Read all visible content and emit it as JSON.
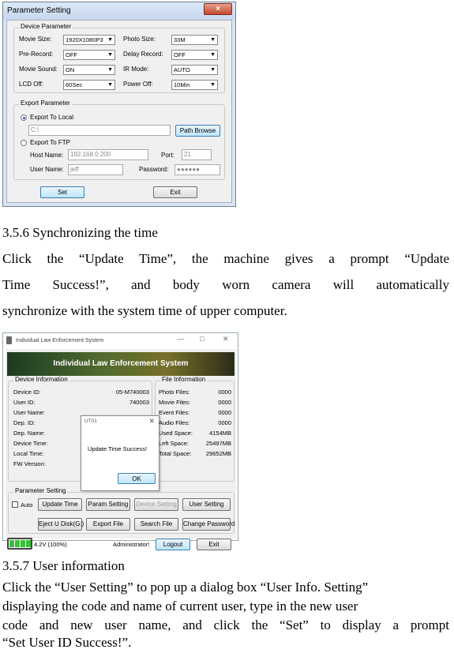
{
  "param_window": {
    "title": "Parameter Setting",
    "close_glyph": "×",
    "device_group": "Device Parameter",
    "fields": [
      {
        "label": "Movie Size:",
        "value": "1920X1080P3"
      },
      {
        "label": "Photo Size:",
        "value": "33M"
      },
      {
        "label": "Pre-Record:",
        "value": "OFF"
      },
      {
        "label": "Delay Record:",
        "value": "OFF"
      },
      {
        "label": "Movie Sound:",
        "value": "ON"
      },
      {
        "label": "IR Mode:",
        "value": "AUTO"
      },
      {
        "label": "LCD Off:",
        "value": "60Sec"
      },
      {
        "label": "Power Off:",
        "value": "10Min"
      }
    ],
    "export_group": "Export Parameter",
    "export_local": "Export To Local",
    "local_path": "C:\\",
    "path_browse": "Path Browse",
    "export_ftp": "Export To FTP",
    "host_label": "Host Name:",
    "host_value": "192.168.0.200",
    "port_label": "Port:",
    "port_value": "21",
    "user_label": "User Name:",
    "user_value": "jeff",
    "password_label": "Password:",
    "password_value": "●●●●●●",
    "set_button": "Set",
    "exit_button": "Exit"
  },
  "section_356": {
    "heading": "3.5.6 Synchronizing the time",
    "line1": "Click the “Update Time”, the machine gives a prompt “Update",
    "line2": "Time Success!”, and body worn camera will automatically",
    "line3": "synchronize with the system time of upper computer."
  },
  "system_window": {
    "title": "Individual Law Enforcement System",
    "min_glyph": "—",
    "max_glyph": "□",
    "close_glyph": "✕",
    "banner": "Individual Law Enforcement System",
    "device_group": "Device Information",
    "device_rows": [
      {
        "label": "Device ID:",
        "value": "05-M740003"
      },
      {
        "label": "User ID:",
        "value": "740003"
      },
      {
        "label": "User Name:",
        "value": ""
      },
      {
        "label": "Dep. ID:",
        "value": ""
      },
      {
        "label": "Dep. Name:",
        "value": ""
      },
      {
        "label": "Device Time:",
        "value": ""
      },
      {
        "label": "Local Time:",
        "value": ""
      },
      {
        "label": "FW Version:",
        "value": ""
      }
    ],
    "file_group": "File Information",
    "file_rows": [
      {
        "label": "Photo Files:",
        "value": "0000"
      },
      {
        "label": "Movie Files:",
        "value": "0000"
      },
      {
        "label": "Event Files:",
        "value": "0000"
      },
      {
        "label": "Audio Files:",
        "value": "0000"
      },
      {
        "label": "Used Space:",
        "value": "4154MB"
      },
      {
        "label": "Left Space:",
        "value": "25497MB"
      },
      {
        "label": "Total Space:",
        "value": "29652MB"
      }
    ],
    "dialog_title": "UT01",
    "dialog_close": "✕",
    "dialog_message": "Update Time Success!",
    "dialog_ok": "OK",
    "param_group": "Parameter Setting",
    "auto_label": "Auto",
    "update_time": "Update Time",
    "param_setting": "Param Setting",
    "device_setting": "Device Setting",
    "user_setting": "User Setting",
    "eject": "Eject U Disk(G:)",
    "export_file": "Export File",
    "search_file": "Search File",
    "change_password": "Change Password",
    "battery_text": "4.2V (100%)",
    "user_text": "Administrator!",
    "logout": "Logout",
    "exit": "Exit"
  },
  "section_357": {
    "heading": "3.5.7 User information",
    "line1": "Click the “User Setting” to pop up a dialog box “User Info. Setting”",
    "line2": "displaying the code and name of current user, type in the new user",
    "line3": "code and new user name, and click the “Set” to display a prompt",
    "line4": "“Set User ID Success!”."
  }
}
